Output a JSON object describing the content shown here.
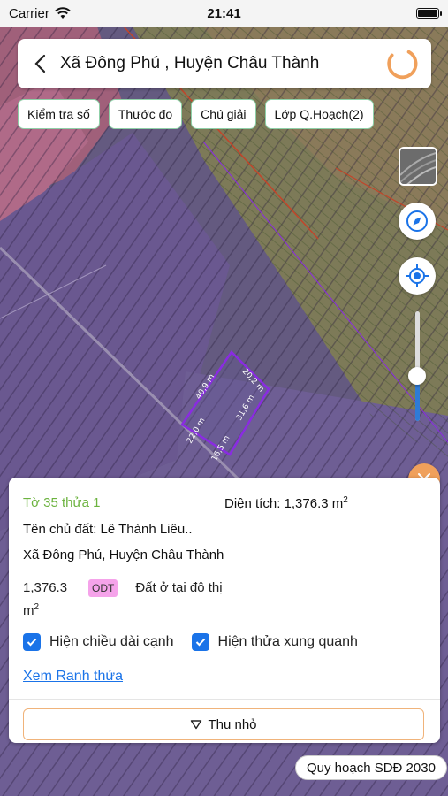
{
  "status_bar": {
    "carrier": "Carrier",
    "time": "21:41"
  },
  "header": {
    "title": "Xã Đông Phú , Huyện Châu Thành"
  },
  "chips": [
    {
      "label": "Kiểm tra số"
    },
    {
      "label": "Thước đo"
    },
    {
      "label": "Chú giải"
    },
    {
      "label": "Lớp Q.Hoạch(2)"
    }
  ],
  "map": {
    "parcel_edges": [
      "40,9 m",
      "20,2 m",
      "31,6 m",
      "16,5 m",
      "22,0 m"
    ],
    "layer_opacity_fraction": 0.15
  },
  "panel": {
    "parcel_id": "Tờ 35 thửa 1",
    "area_label": "Diện tích: 1,376.3 m",
    "area_sup": "2",
    "owner": "Tên chủ đất: Lê Thành Liêu..",
    "address": "Xã Đông Phú, Huyện Châu Thành",
    "use_area": "1,376.3",
    "use_unit": "m",
    "use_unit_sup": "2",
    "use_code": "ODT",
    "use_code_color": "#f5a3ea",
    "use_name": "Đất ở tại đô thị",
    "check_edges": "Hiện chiều dài cạnh",
    "check_neighbors": "Hiện thửa xung quanh",
    "link": "Xem Ranh thửa",
    "collapse": "Thu nhỏ"
  },
  "plan_badge": "Quy hoạch SDĐ 2030",
  "colors": {
    "accent": "#1a73e8",
    "parcel_id": "#6cb33f",
    "orange": "#f0a05b",
    "boundary": "#8a2be2"
  }
}
